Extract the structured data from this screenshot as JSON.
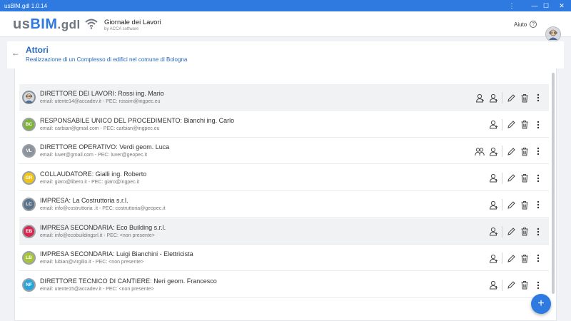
{
  "window": {
    "title": "usBIM.gdl 1.0.14",
    "controls": [
      "⋮",
      "—",
      "☐",
      "✕"
    ]
  },
  "app": {
    "logo_us": "us",
    "logo_bim": "BIM",
    "logo_gdl": ".gdl",
    "product_name": "Giornale dei Lavori",
    "product_sub": "by ACCA software",
    "help_label": "Aiuto",
    "help_icon": "?"
  },
  "page": {
    "back_icon": "←",
    "title": "Attori",
    "subtitle": "Realizzazione di un Complesso di edifici nel comune di Bologna"
  },
  "actors": [
    {
      "initials": "",
      "role": "DIRETTORE DEI LAVORI",
      "name": "Rossi ing. Mario",
      "email": "utente14@accadev.it",
      "pec": "rossim@ingpec.eu",
      "color": "#d6dade",
      "border": "#8a9098",
      "highlight": true,
      "group_icon": false,
      "photo": true
    },
    {
      "initials": "BC",
      "role": "RESPONSABILE UNICO DEL PROCEDIMENTO",
      "name": "Bianchi ing. Carlo",
      "email": "carbian@gmail.com",
      "pec": "carbian@ingpec.eu",
      "color": "#7fb23b",
      "border": "#9aa1a9",
      "highlight": false,
      "group_icon": false,
      "photo": false
    },
    {
      "initials": "VL",
      "role": "DIRETTORE OPERATIVO",
      "name": "Verdi geom. Luca",
      "email": "luver@gmail.com",
      "pec": "luver@geopec.it",
      "color": "#8c939c",
      "border": "#9aa1a9",
      "highlight": false,
      "group_icon": true,
      "photo": false
    },
    {
      "initials": "GR",
      "role": "COLLAUDATORE",
      "name": "Gialli ing. Roberto",
      "email": "giaro@libero.it",
      "pec": "giaro@ingpec.it",
      "color": "#f0c419",
      "border": "#9aa1a9",
      "highlight": false,
      "group_icon": false,
      "photo": false
    },
    {
      "initials": "LC",
      "role": "IMPRESA",
      "name": "La Costruttoria s.r.l.",
      "email": "info@costruttoria .it",
      "pec": "costruttoria@geopec.it",
      "color": "#5a7388",
      "border": "#9aa1a9",
      "highlight": false,
      "group_icon": false,
      "photo": false
    },
    {
      "initials": "EB",
      "role": "IMPRESA SECONDARIA",
      "name": "Eco Building s.r.l.",
      "email": "info@ecobuildingsrl.it",
      "pec": "<non presente>",
      "color": "#d9264f",
      "border": "#9aa1a9",
      "highlight": true,
      "group_icon": false,
      "photo": false
    },
    {
      "initials": "LB",
      "role": "IMPRESA SECONDARIA",
      "name": "Luigi Bianchini - Elettricista",
      "email": "lubian@virgilio.it",
      "pec": "<non presente>",
      "color": "#a7c43a",
      "border": "#9aa1a9",
      "highlight": false,
      "group_icon": false,
      "photo": false
    },
    {
      "initials": "NF",
      "role": "DIRETTORE TECNICO DI CANTIERE",
      "name": "Neri geom. Francesco",
      "email": "utente15@accadev.it",
      "pec": "<non presente>",
      "color": "#2aa4d9",
      "border": "#9aa1a9",
      "highlight": false,
      "group_icon": false,
      "photo": false
    }
  ],
  "labels": {
    "email_prefix": "email: ",
    "pec_prefix": " - PEC: ",
    "separator": ": "
  },
  "fab": {
    "label": "+"
  },
  "colors": {
    "accent": "#2f7ae0",
    "title": "#2a6ab8"
  }
}
